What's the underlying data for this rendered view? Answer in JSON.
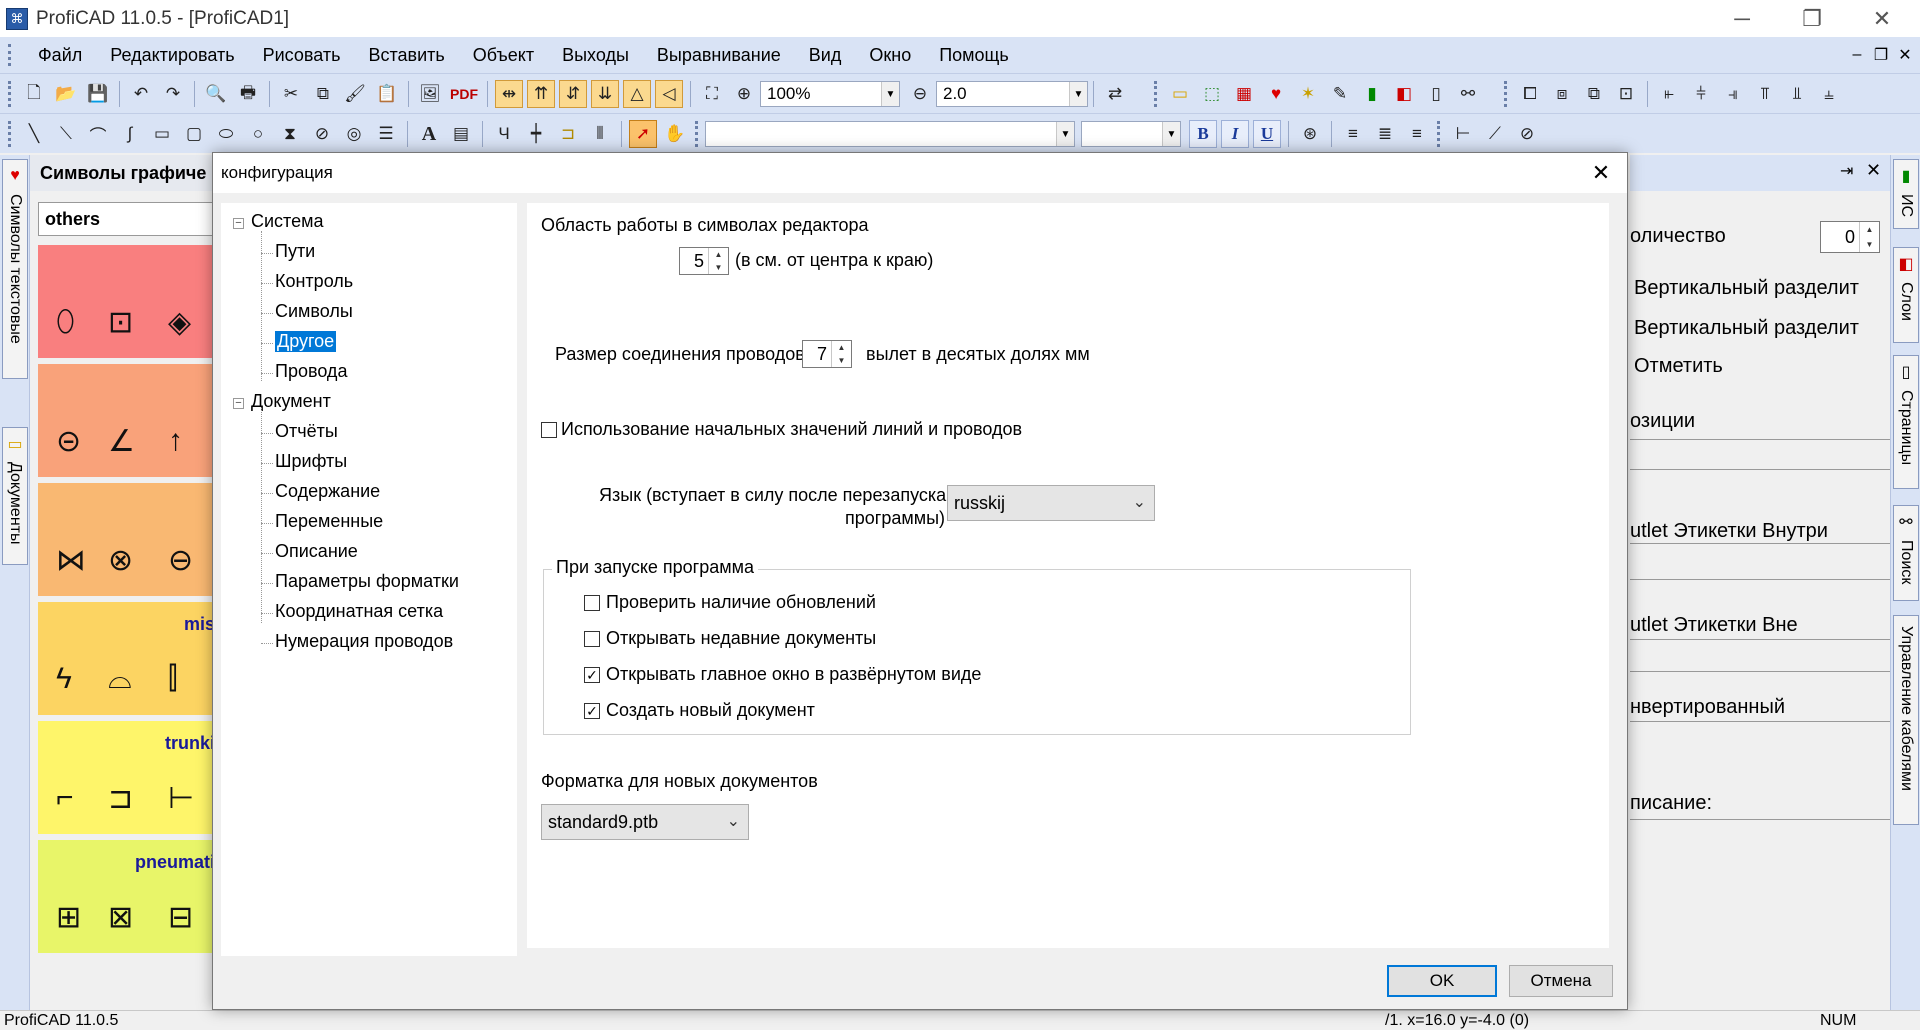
{
  "window": {
    "title": "ProfiCAD 11.0.5 - [ProfiCAD1]",
    "app_icon": "proficad-icon",
    "minimize": "─",
    "restore": "❐",
    "close": "✕"
  },
  "menu": {
    "items": [
      "Файл",
      "Редактировать",
      "Рисовать",
      "Вставить",
      "Объект",
      "Выходы",
      "Выравнивание",
      "Вид",
      "Окно",
      "Помощь"
    ],
    "mdi_min": "–",
    "mdi_restore": "❐",
    "mdi_close": "✕"
  },
  "toolbar": {
    "zoom_value": "100%",
    "line_width": "2.0",
    "pdf_label": "PDF",
    "bold": "B",
    "italic": "I",
    "underline": "U",
    "font_name": "",
    "font_size": "",
    "text_tool": "A"
  },
  "left_tabs": [
    "Символы текстовые",
    "Документы"
  ],
  "symbols_panel": {
    "title": "Символы графиче",
    "category": "others",
    "bands": [
      {
        "color": "#f97f7f",
        "cat": ""
      },
      {
        "color": "#f9a27a",
        "cat": ""
      },
      {
        "color": "#f9b872",
        "cat": ""
      },
      {
        "color": "#fcd462",
        "cat": "mis"
      },
      {
        "color": "#fef56a",
        "cat": "trunki"
      },
      {
        "color": "#e8f569",
        "cat": "pneumati"
      }
    ]
  },
  "right_panel": {
    "pin": "⇥",
    "close": "✕",
    "quantity_label": "оличество",
    "quantity_value": "0",
    "lines": [
      "Вертикальный разделит",
      "Вертикальный разделит",
      "Отметить",
      "озиции",
      "utlet Этикетки Внутри",
      "utlet Этикетки Вне",
      "нвертированный",
      "писание:"
    ]
  },
  "right_tabs": [
    "ИС",
    "Слои",
    "Страницы",
    "Поиск",
    "Управление кабелями"
  ],
  "status": {
    "left": "ProfiCAD 11.0.5",
    "coords": "/1.  x=16.0  y=-4.0 (0)",
    "num": "NUM"
  },
  "dialog": {
    "title": "конфигурация",
    "close": "✕",
    "tree": [
      {
        "label": "Система",
        "level": 0,
        "expanded": true
      },
      {
        "label": "Пути",
        "level": 1
      },
      {
        "label": "Контроль",
        "level": 1
      },
      {
        "label": "Символы",
        "level": 1
      },
      {
        "label": "Другое",
        "level": 1,
        "selected": true
      },
      {
        "label": "Провода",
        "level": 1
      },
      {
        "label": "Документ",
        "level": 0,
        "expanded": true
      },
      {
        "label": "Отчёты",
        "level": 1
      },
      {
        "label": "Шрифты",
        "level": 1
      },
      {
        "label": "Содержание",
        "level": 1
      },
      {
        "label": "Переменные",
        "level": 1
      },
      {
        "label": "Описание",
        "level": 1
      },
      {
        "label": "Параметры форматки",
        "level": 1
      },
      {
        "label": "Координатная сетка",
        "level": 1
      },
      {
        "label": "Нумерация проводов",
        "level": 1
      }
    ],
    "symbol_area_label": "Область работы в символах редактора",
    "symbol_area_value": "5",
    "symbol_area_unit": "(в см. от центра к краю)",
    "wire_joint_label": "Размер соединения проводов",
    "wire_joint_value": "7",
    "wire_joint_unit": "вылет в десятых долях мм",
    "initial_values_label": "Использование начальных значений линий и проводов",
    "initial_values_checked": false,
    "language_label_1": "Язык (вступает в силу после перезапуска",
    "language_label_2": "программы)",
    "language_value": "russkij",
    "startup_group": "При запуске программа",
    "startup": [
      {
        "label": "Проверить наличие обновлений",
        "checked": false
      },
      {
        "label": "Открывать недавние документы",
        "checked": false
      },
      {
        "label": "Открывать главное окно в развёрнутом виде",
        "checked": true
      },
      {
        "label": "Создать новый документ",
        "checked": true
      }
    ],
    "template_label": "Форматка для новых документов",
    "template_value": "standard9.ptb",
    "ok": "OK",
    "cancel": "Отмена"
  }
}
